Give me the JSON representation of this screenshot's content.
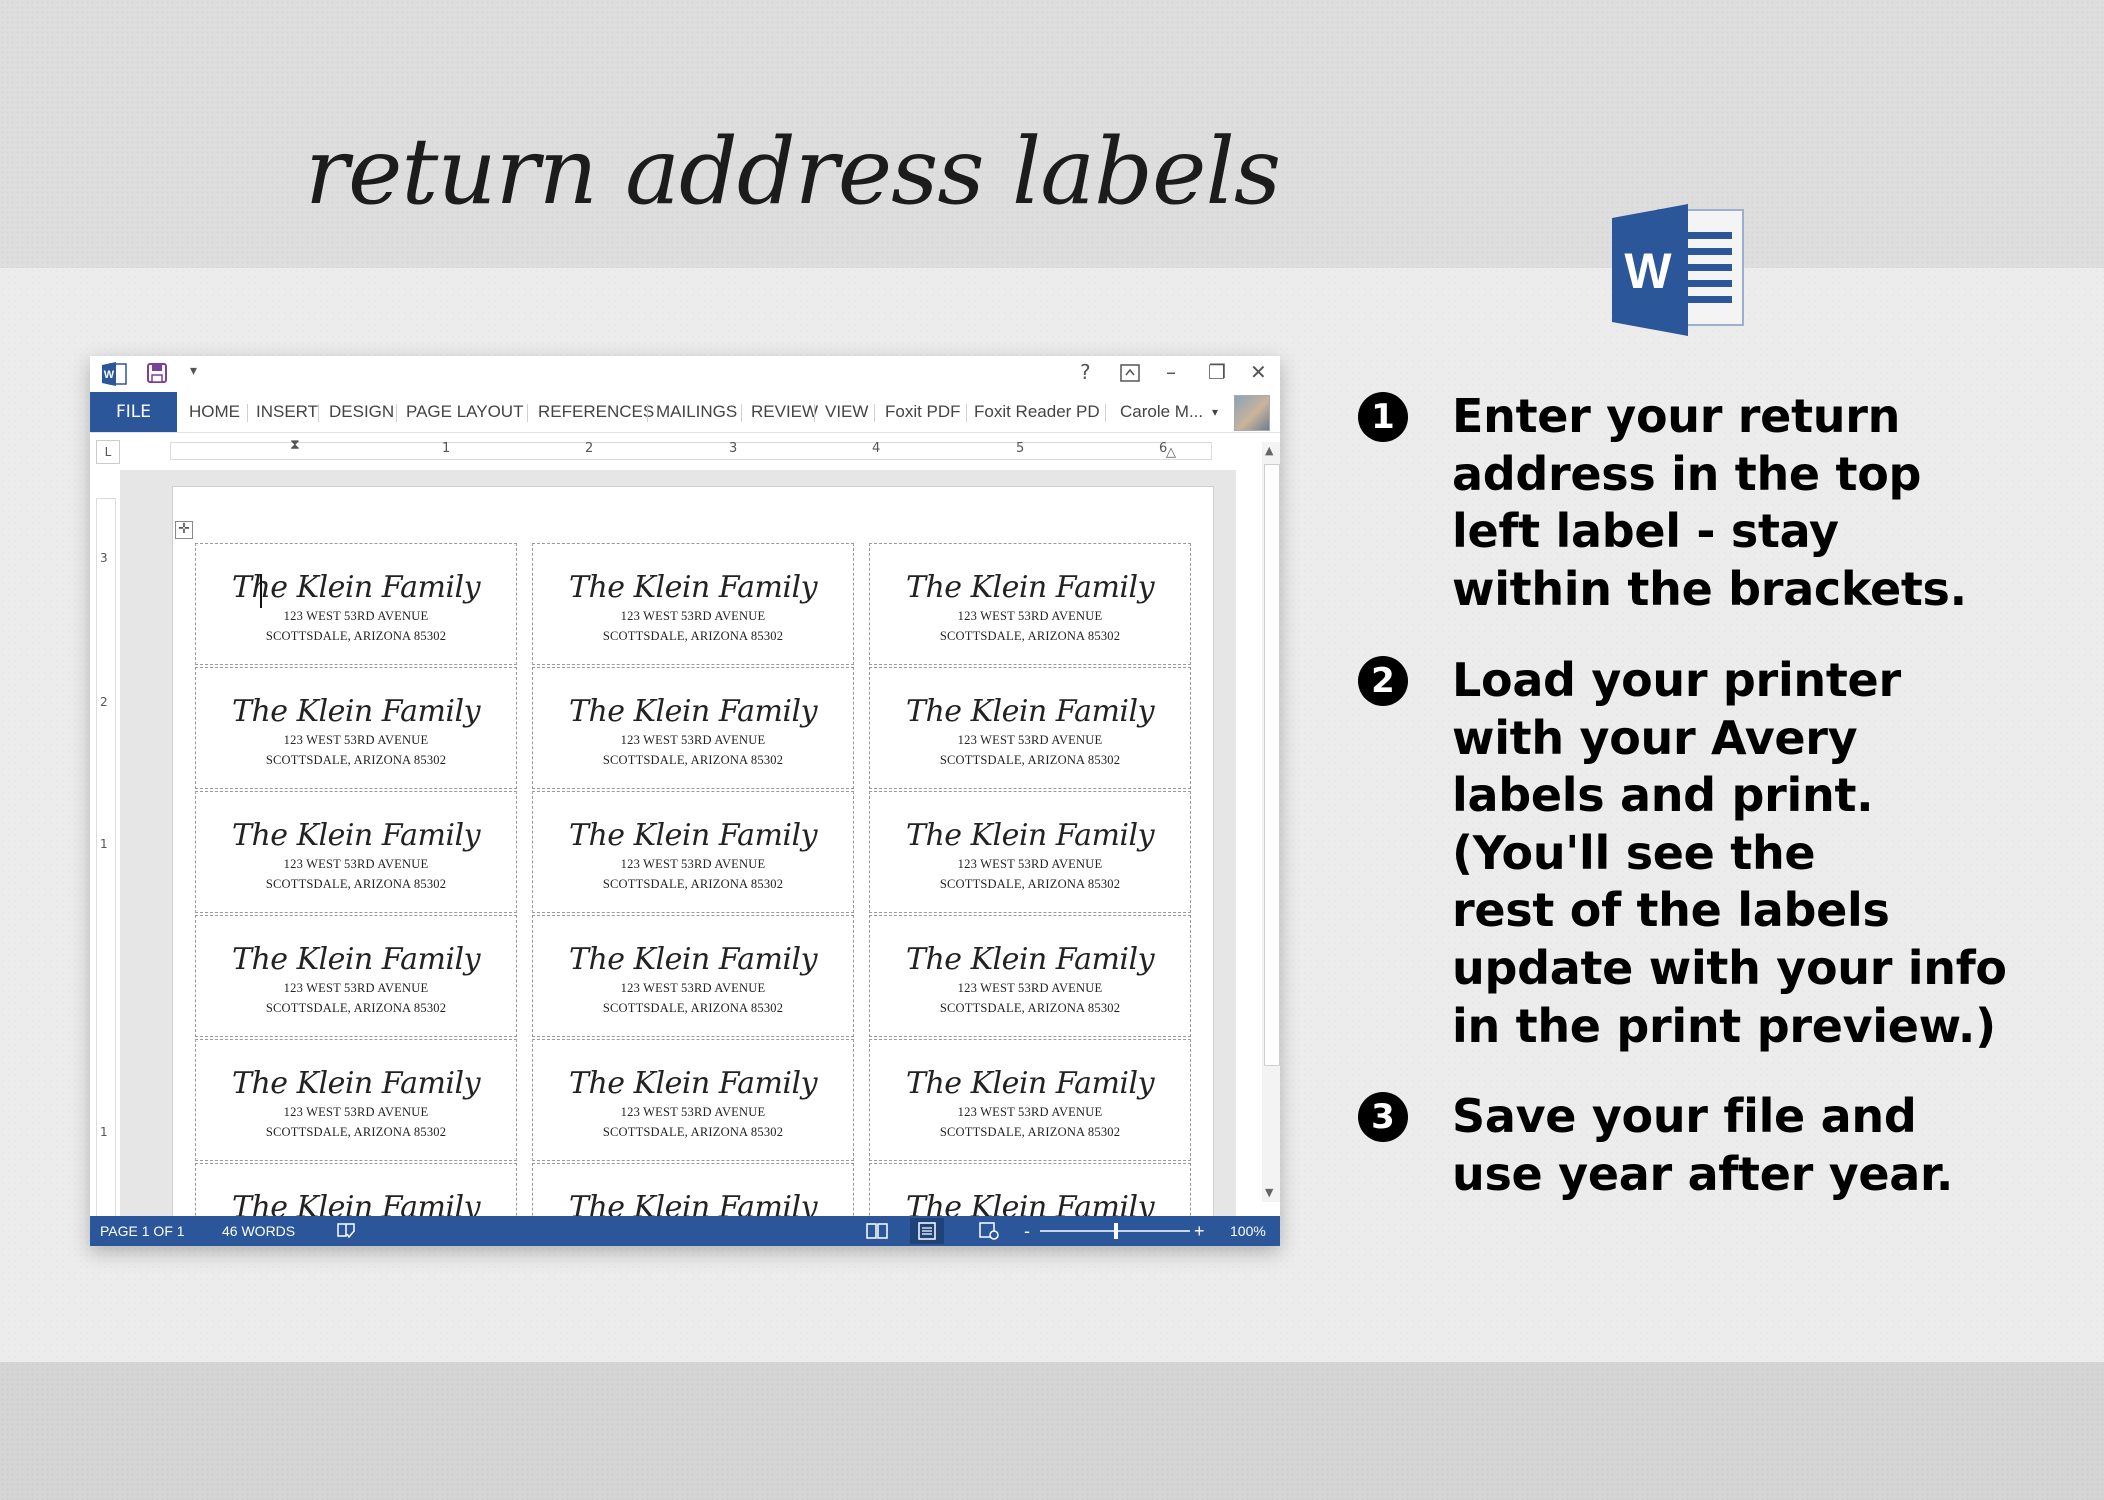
{
  "headline": "return address labels",
  "logo": {
    "letter": "W",
    "color": "#2b579a"
  },
  "window": {
    "tabs": [
      "FILE",
      "HOME",
      "INSERT",
      "DESIGN",
      "PAGE LAYOUT",
      "REFERENCES",
      "MAILINGS",
      "REVIEW",
      "VIEW",
      "Foxit PDF",
      "Foxit Reader PD"
    ],
    "user_name": "Carole M...",
    "title_buttons": {
      "help": "?",
      "minimize": "–",
      "restore": "❐",
      "close": "✕"
    },
    "ruler_numbers": [
      "1",
      "2",
      "3",
      "4",
      "5",
      "6"
    ],
    "vruler_numbers": [
      "3",
      "2",
      "1",
      "1"
    ],
    "corner": "L"
  },
  "label": {
    "name": "The Klein Family",
    "line1": "123 WEST 53RD AVENUE",
    "line2": "SCOTTSDALE, ARIZONA 85302"
  },
  "status": {
    "page": "PAGE 1 OF 1",
    "words": "46 WORDS",
    "zoom_minus": "-",
    "zoom_plus": "+",
    "zoom": "100%"
  },
  "steps": [
    {
      "num": "1",
      "text": "Enter your return\naddress in the top\nleft label - stay\nwithin the brackets."
    },
    {
      "num": "2",
      "text": "Load your printer\nwith your Avery\nlabels and print.\n(You'll see the\nrest of the labels\nupdate with your info\nin the print preview.)"
    },
    {
      "num": "3",
      "text": "Save your file and\nuse year after year."
    }
  ],
  "colors": {
    "word_blue": "#2b579a",
    "background": "#ececec"
  }
}
